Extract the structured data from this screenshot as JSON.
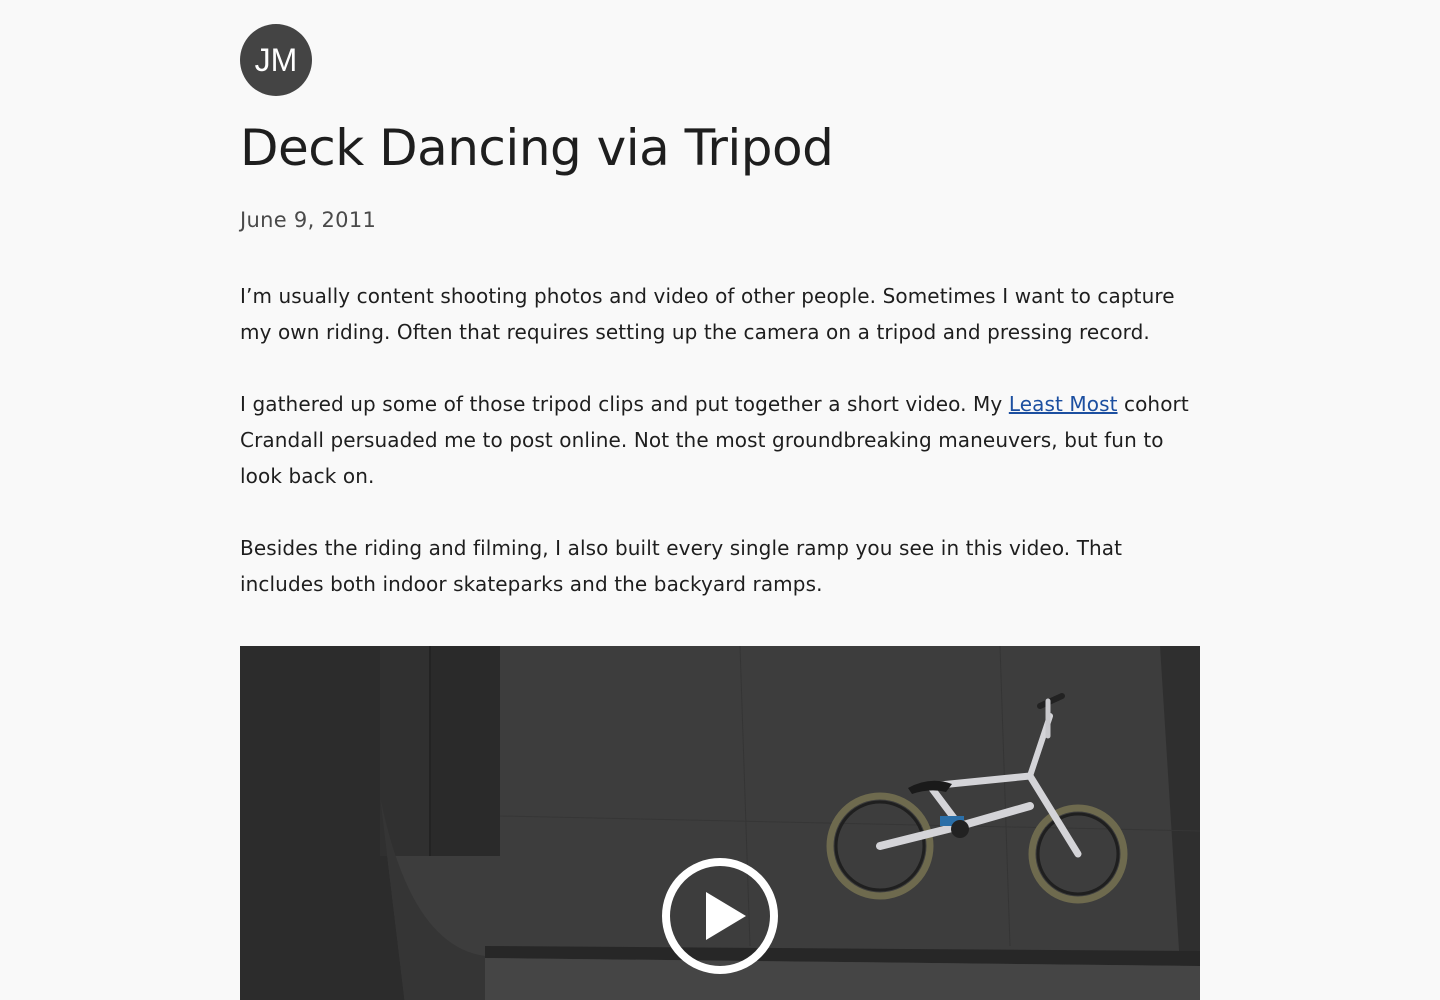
{
  "author": {
    "initials": "JM"
  },
  "post": {
    "title": "Deck Dancing via Tripod",
    "date": "June 9, 2011",
    "paragraph1": "I’m usually content shooting photos and video of other people. Sometimes I want to capture my own riding. Often that requires setting up the camera on a tripod and pressing record.",
    "paragraph2_before": "I gathered up some of those tripod clips and put together a short video. My ",
    "paragraph2_link": "Least Most",
    "paragraph2_after": " cohort Crandall persuaded me to post online. Not the most groundbreaking maneuvers, but fun to look back on.",
    "paragraph3": "Besides the riding and filming, I also built every single ramp you see in this video. That includes both indoor skateparks and the backyard ramps."
  },
  "video": {
    "play_icon": "play-icon",
    "thumbnail_subject": "bmx-bike-on-ramp-deck"
  },
  "colors": {
    "link": "#1c4fa0",
    "avatar_bg": "#444444",
    "page_bg": "#f9f9f9"
  }
}
